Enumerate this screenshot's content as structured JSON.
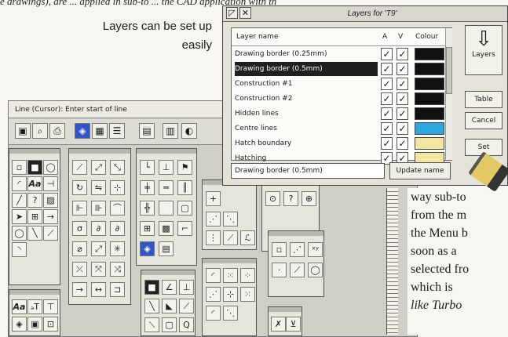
{
  "article": {
    "top_text": "e drawings), are ... applied in sub-to ... the CAD application with th",
    "caption": "Layers can be set up easily",
    "column_lines": [
      "way sub-to",
      "from the m",
      "the Menu b",
      "soon as a",
      "selected fro",
      "which is",
      "like Turbo"
    ]
  },
  "cad": {
    "status_text": "Line (Cursor): Enter start of line",
    "toolbar_icons": [
      "save-icon",
      "zoom-icon",
      "print-icon",
      "layers-icon",
      "grid-icon",
      "list-icon",
      "calculator-icon",
      "paint-icon"
    ],
    "palette_glyphs": [
      "Aa",
      "Aa",
      "ℱ",
      "⊕",
      "⊙",
      "◯",
      "⊡"
    ]
  },
  "layers_dialog": {
    "title": "Layers for 'T9'",
    "columns": {
      "name": "Layer name",
      "a": "A",
      "v": "V",
      "colour": "Colour"
    },
    "rows": [
      {
        "name": "Drawing border (0.25mm)",
        "a": "✓",
        "v": "✓",
        "colour": "#111111",
        "selected": false
      },
      {
        "name": "Drawing border (0.5mm)",
        "a": "✓",
        "v": "✓",
        "colour": "#111111",
        "selected": true
      },
      {
        "name": "Construction #1",
        "a": "✓",
        "v": "✓",
        "colour": "#111111",
        "selected": false
      },
      {
        "name": "Construction #2",
        "a": "✓",
        "v": "✓",
        "colour": "#111111",
        "selected": false
      },
      {
        "name": "Hidden lines",
        "a": "✓",
        "v": "✓",
        "colour": "#111111",
        "selected": false
      },
      {
        "name": "Centre lines",
        "a": "✓",
        "v": "✓",
        "colour": "#2aa7de",
        "selected": false
      },
      {
        "name": "Hatch boundary",
        "a": "✓",
        "v": "✓",
        "colour": "#f3e6a3",
        "selected": false
      },
      {
        "name": "Hatching",
        "a": "✓",
        "v": "✓",
        "colour": "#f3e6a3",
        "selected": false
      }
    ],
    "name_input_value": "Drawing border (0.5mm)",
    "update_button": "Update name",
    "layers_button": "Layers",
    "table_button": "Table",
    "cancel_button": "Cancel",
    "set_button": "Set"
  }
}
